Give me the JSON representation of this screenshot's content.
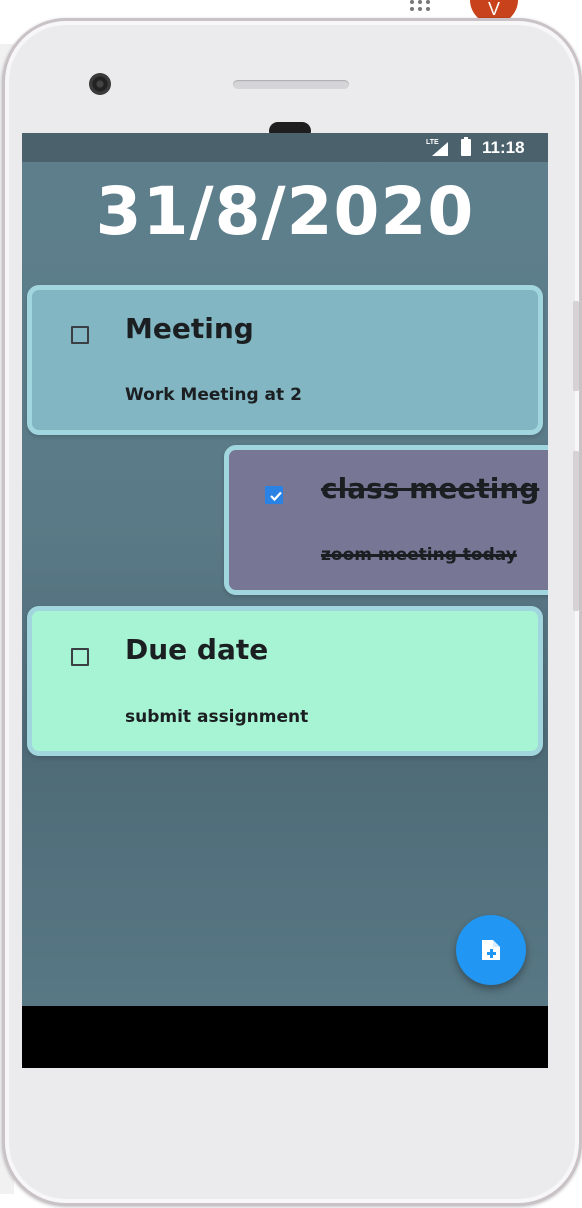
{
  "browser": {
    "avatar_letter": "V"
  },
  "status_bar": {
    "network": "LTE",
    "time": "11:18"
  },
  "header": {
    "date": "31/8/2020"
  },
  "tasks": [
    {
      "title": "Meeting",
      "description": "Work Meeting at 2",
      "completed": false,
      "color": "#81b6c2"
    },
    {
      "title": "class meeting",
      "description": "zoom meeting today",
      "completed": true,
      "color": "#777695"
    },
    {
      "title": "Due date",
      "description": "submit assignment",
      "completed": false,
      "color": "#a7f4d5"
    }
  ],
  "fab": {
    "icon": "add-note-icon",
    "color": "#2196f3"
  },
  "colors": {
    "screen_background": "#5e7f8c",
    "card_border": "#a2d6df",
    "status_bar": "#4b626d"
  }
}
